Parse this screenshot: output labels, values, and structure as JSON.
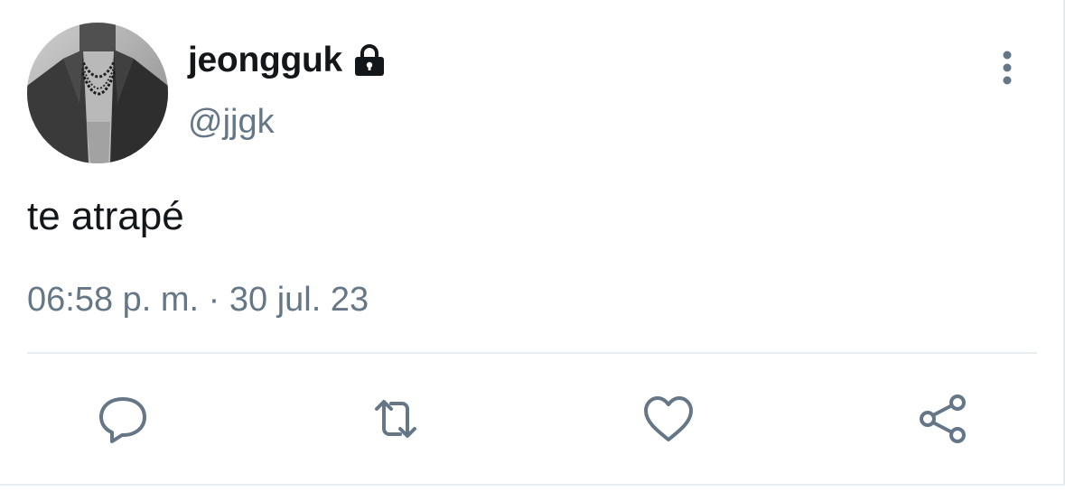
{
  "user": {
    "display_name": "jeongguk",
    "handle": "@jjgk",
    "avatar_icon": "avatar-photo",
    "protected_icon": "lock-icon"
  },
  "tweet": {
    "text": "te atrapé",
    "timestamp": "06:58 p. m. · 30 jul. 23"
  },
  "actions": [
    {
      "name": "reply",
      "icon": "speech-bubble-icon"
    },
    {
      "name": "retweet",
      "icon": "retweet-icon"
    },
    {
      "name": "like",
      "icon": "heart-icon"
    },
    {
      "name": "share",
      "icon": "share-icon"
    }
  ],
  "colors": {
    "text_primary": "#14171a",
    "text_secondary": "#657786",
    "divider": "#e6ecf0"
  }
}
